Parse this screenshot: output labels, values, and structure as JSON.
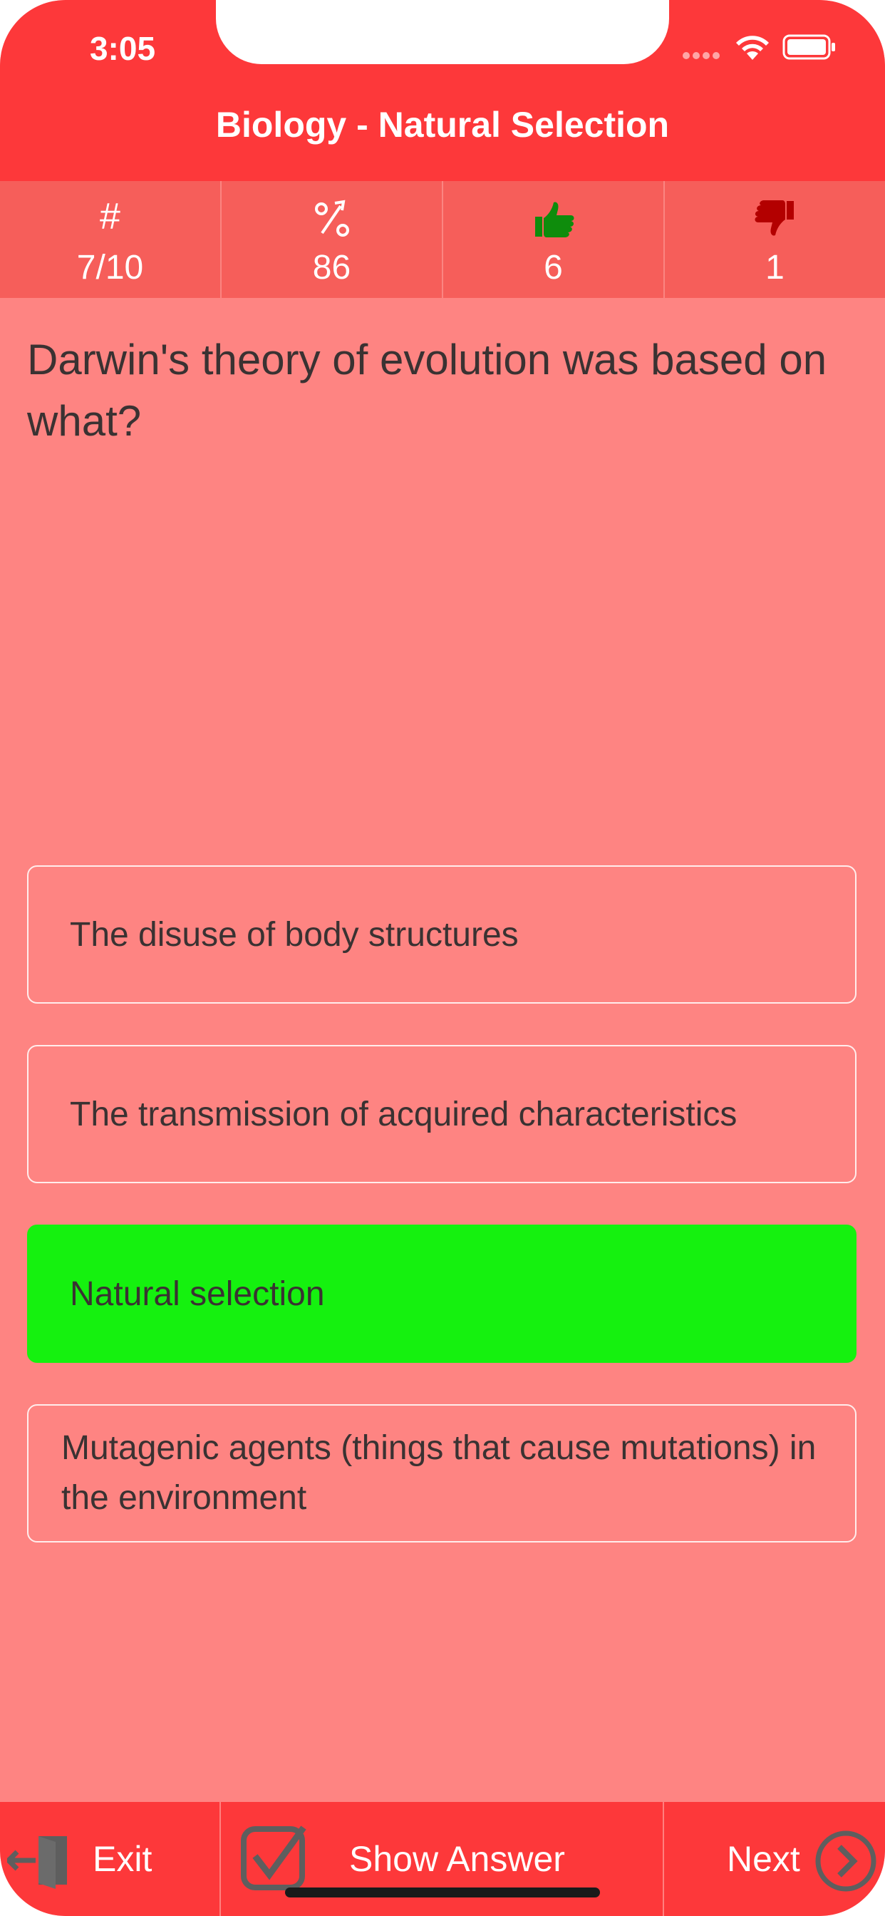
{
  "status_bar": {
    "time": "3:05"
  },
  "nav": {
    "title": "Biology - Natural Selection"
  },
  "stats": [
    {
      "icon": "hash-icon",
      "symbol": "#",
      "value": "7/10"
    },
    {
      "icon": "percent-up-icon",
      "symbol": "%",
      "value": "86"
    },
    {
      "icon": "thumbs-up-icon",
      "symbol": "",
      "value": "6"
    },
    {
      "icon": "thumbs-down-icon",
      "symbol": "",
      "value": "1"
    }
  ],
  "question": {
    "text": "Darwin's theory of evolution was based on what?"
  },
  "answers": [
    {
      "text": "The disuse of body structures",
      "state": "default"
    },
    {
      "text": "The transmission of acquired characteristics",
      "state": "default"
    },
    {
      "text": "Natural selection",
      "state": "correct"
    },
    {
      "text": "Mutagenic agents (things that cause mutations) in the environment",
      "state": "default"
    }
  ],
  "toolbar": {
    "exit_label": "Exit",
    "show_answer_label": "Show Answer",
    "next_label": "Next"
  },
  "colors": {
    "header": "#fd383a",
    "stats_bar": "#f65e5a",
    "background": "#fe8482",
    "correct": "#15f10f",
    "thumbs_up": "#0e8c0c",
    "thumbs_down": "#b30000"
  }
}
